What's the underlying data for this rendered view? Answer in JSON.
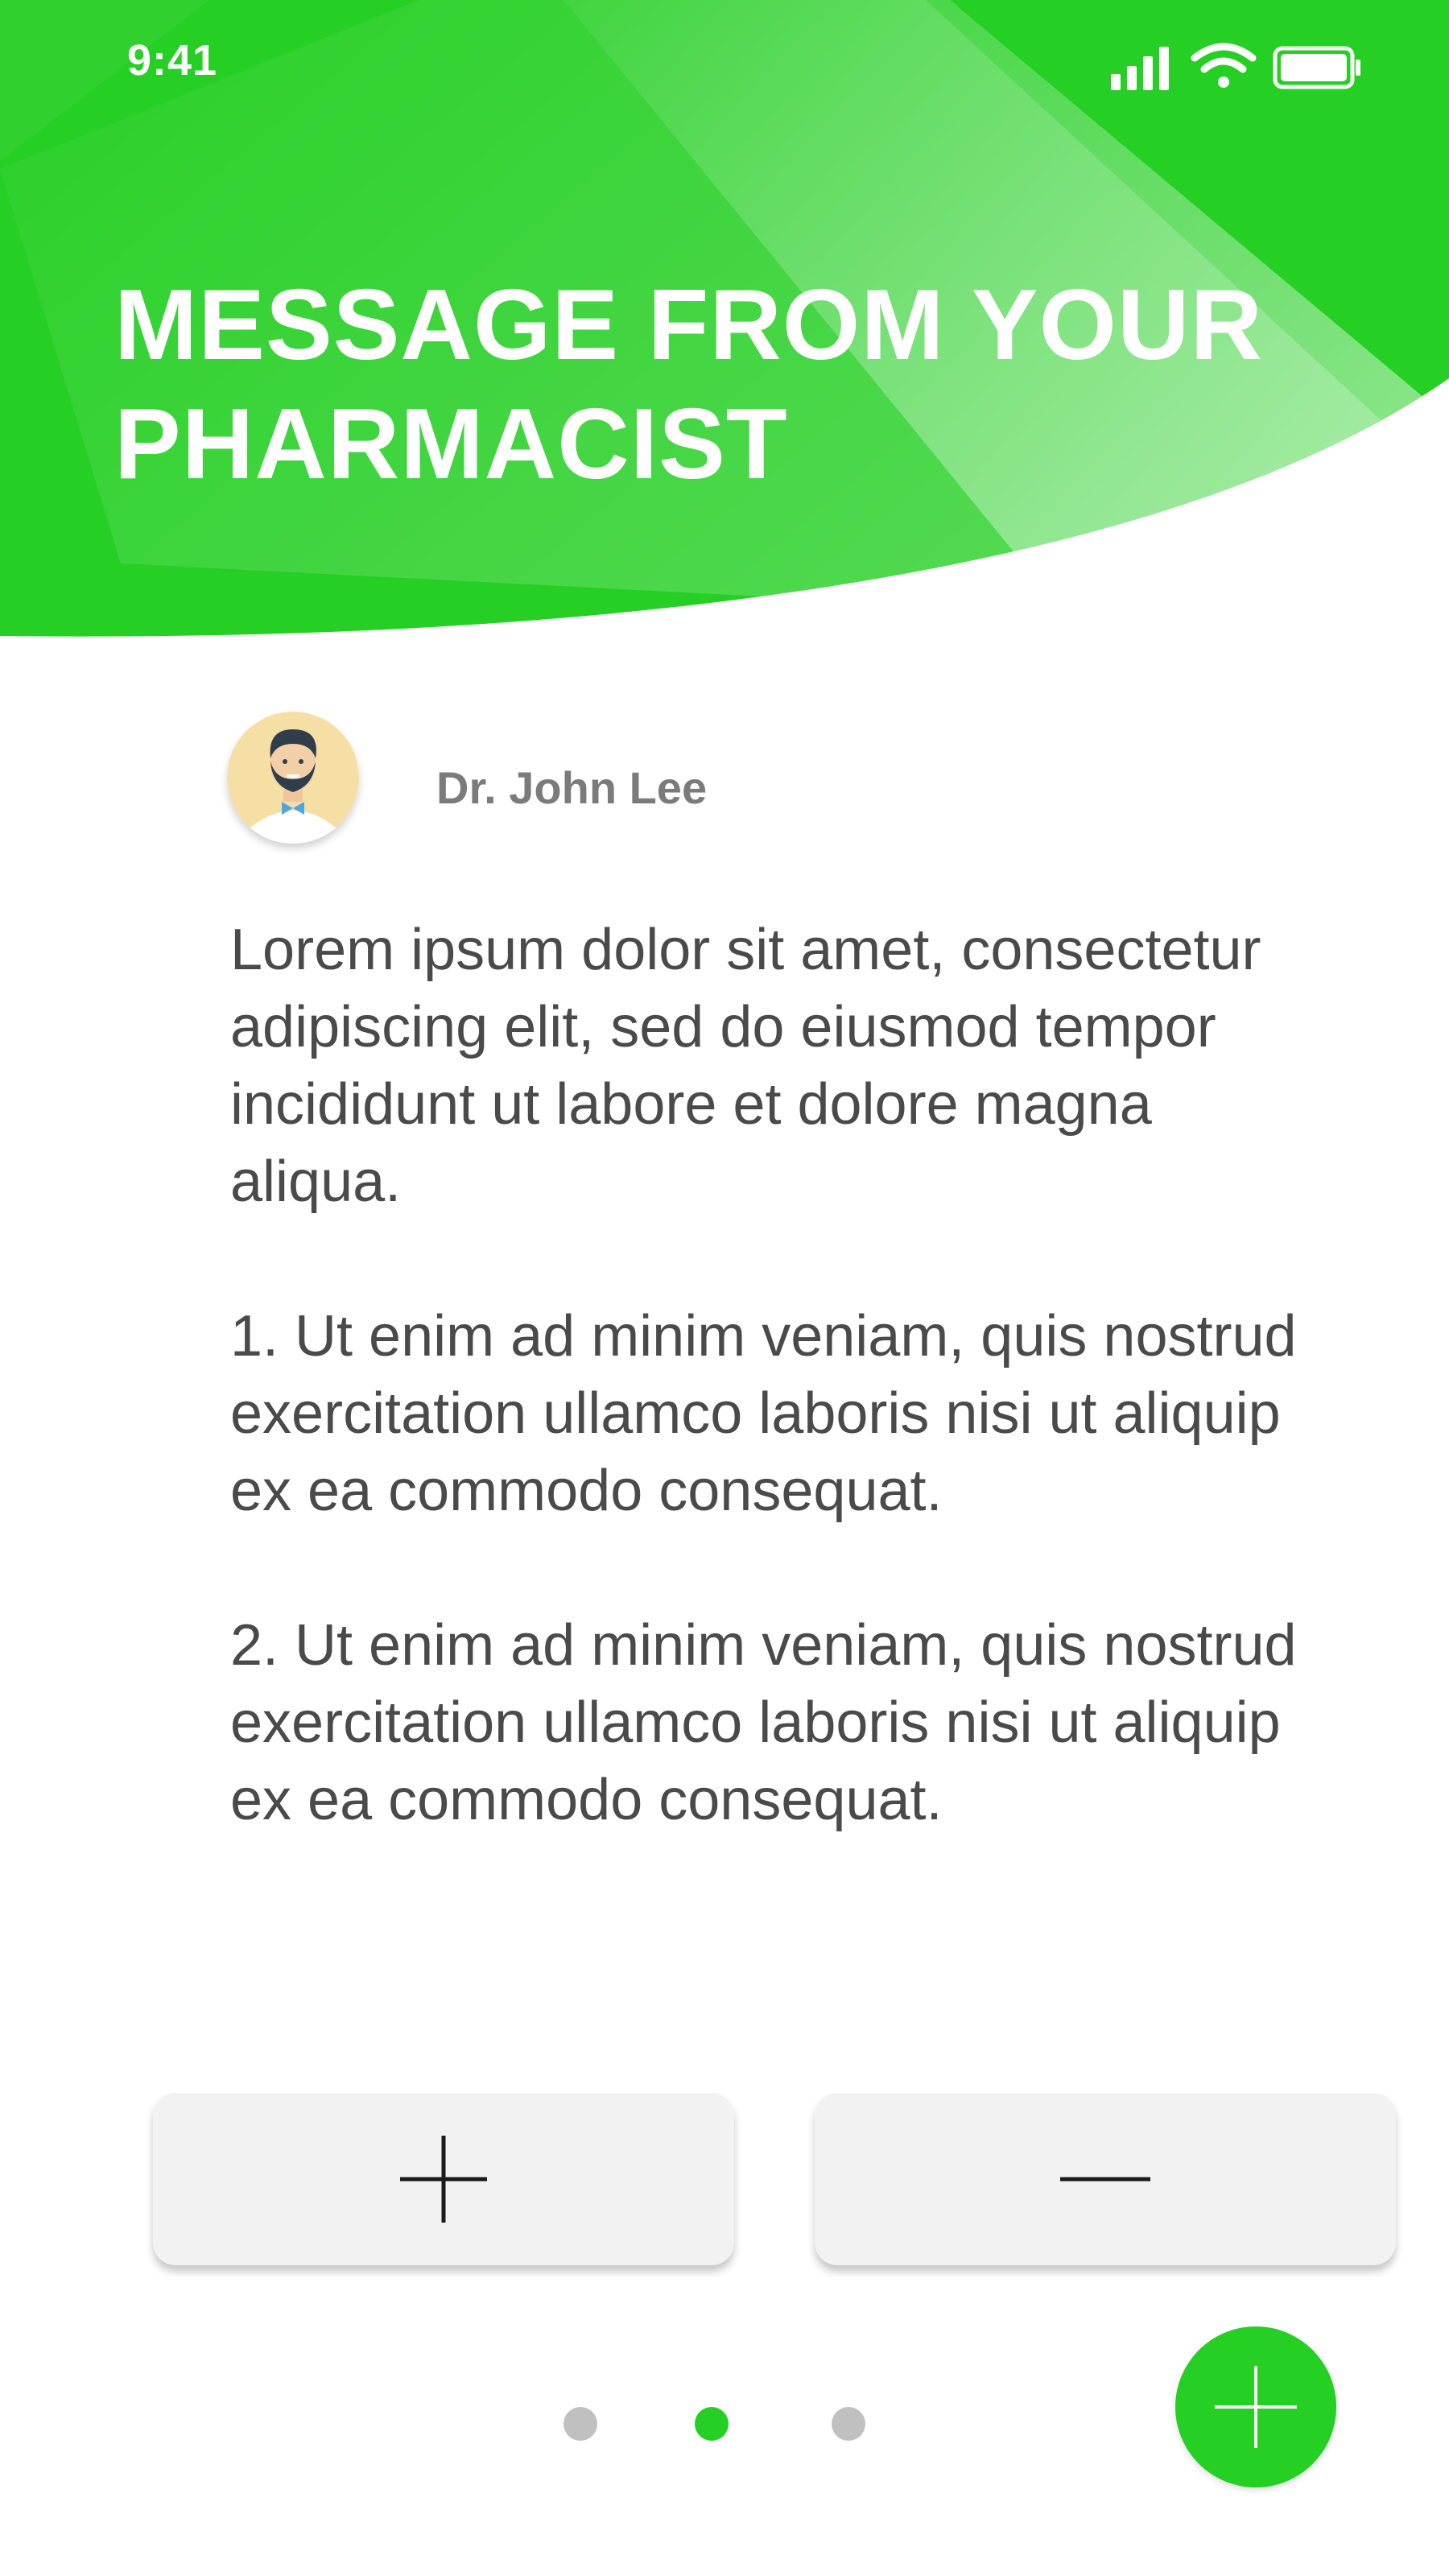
{
  "status_bar": {
    "time": "9:41",
    "icons": [
      "cellular-signal-icon",
      "wifi-icon",
      "battery-icon"
    ]
  },
  "header": {
    "title_lines": [
      "MESSAGE FROM YOUR",
      "PHARMACIST"
    ],
    "background_color": "#25cf24"
  },
  "author": {
    "name": "Dr. John Lee",
    "avatar_icon": "doctor-avatar-icon"
  },
  "message": {
    "paragraphs": [
      "Lorem ipsum dolor sit amet, consectetur adipiscing elit, sed do eiusmod tempor incididunt ut labore et dolore magna aliqua.",
      "1. Ut enim ad minim veniam, quis nostrud exercitation ullamco laboris nisi ut aliquip ex ea commodo consequat.",
      "2. Ut enim ad minim veniam, quis nostrud exercitation ullamco laboris nisi ut aliquip ex ea commodo consequat."
    ]
  },
  "actions": {
    "increase_icon": "plus-icon",
    "decrease_icon": "minus-icon",
    "button_color": "#f2f2f2"
  },
  "pagination": {
    "count": 3,
    "active_index": 1,
    "active_color": "#25cf24",
    "inactive_color": "#c0c0c0"
  },
  "fab": {
    "icon": "plus-icon",
    "color": "#25cf24"
  }
}
